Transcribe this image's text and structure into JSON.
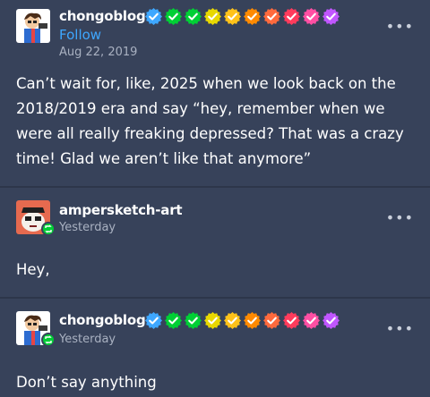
{
  "posts": [
    {
      "username": "chongoblog",
      "follow_label": "Follow",
      "timestamp": "Aug 22, 2019",
      "text": "Can’t wait for, like, 2025 when we look back on the 2018/2019 era and say “hey, remember when we were all really freaking depressed? That was a crazy time! Glad we aren’t like that anymore”"
    },
    {
      "username": "ampersketch-art",
      "timestamp": "Yesterday",
      "text": "Hey,"
    },
    {
      "username": "chongoblog",
      "timestamp": "Yesterday",
      "text": "Don’t say anything"
    }
  ],
  "more_icon_glyph": "•••",
  "badge_colors": [
    "#3ea7ff",
    "#00cf35",
    "#00cf35",
    "#e8d800",
    "#ffc21a",
    "#ff8a00",
    "#ff6a3d",
    "#ff3b5c",
    "#ff4fa3",
    "#c056ff"
  ],
  "reblog_color": "#00cf35"
}
